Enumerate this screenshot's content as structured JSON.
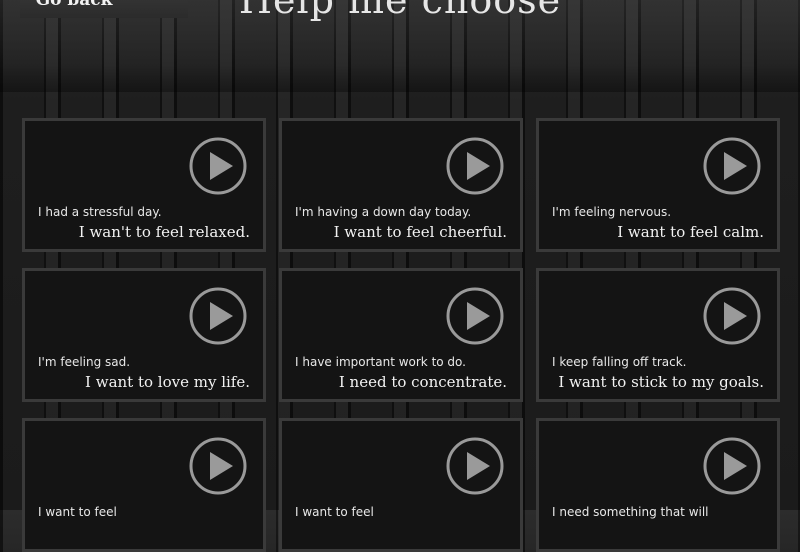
{
  "header": {
    "back_label": "Go back",
    "title": "Help me choose"
  },
  "cards": [
    {
      "situation": "I had a stressful day.",
      "goal": "I wan't to feel relaxed."
    },
    {
      "situation": "I'm having a down day today.",
      "goal": "I want to feel cheerful."
    },
    {
      "situation": "I'm feeling nervous.",
      "goal": "I want to feel calm."
    },
    {
      "situation": "I'm feeling sad.",
      "goal": "I want to love my life."
    },
    {
      "situation": "I have important work to do.",
      "goal": "I need to concentrate."
    },
    {
      "situation": "I keep falling off track.",
      "goal": "I want to stick to my goals."
    },
    {
      "situation": "I want to feel",
      "goal": ""
    },
    {
      "situation": "I want to feel",
      "goal": ""
    },
    {
      "situation": "I need something that will",
      "goal": ""
    }
  ],
  "icons": {
    "play": "play-icon"
  },
  "colors": {
    "card_bg": "#141414",
    "card_border": "#3a3a3a",
    "icon": "#9a9a9a"
  }
}
